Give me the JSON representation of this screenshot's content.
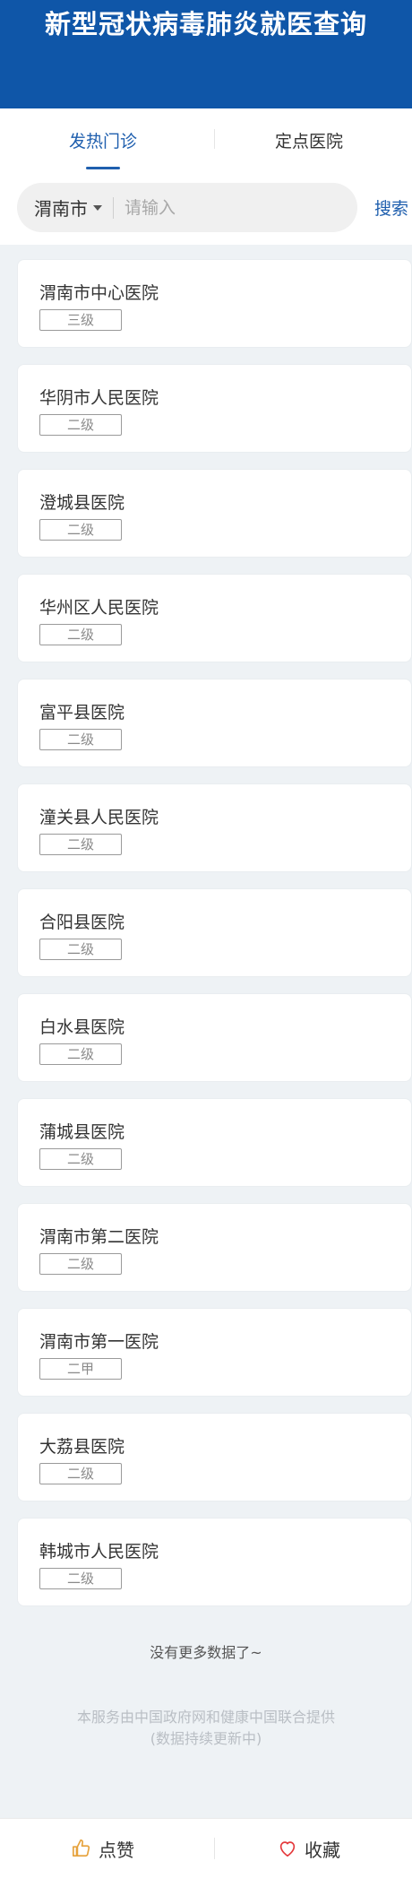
{
  "header": {
    "title": "新型冠状病毒肺炎就医查询"
  },
  "tabs": [
    {
      "label": "发热门诊",
      "active": true
    },
    {
      "label": "定点医院",
      "active": false
    }
  ],
  "search": {
    "city": "渭南市",
    "placeholder": "请输入",
    "value": "",
    "button_label": "搜索"
  },
  "hospitals": [
    {
      "name": "渭南市中心医院",
      "level": "三级"
    },
    {
      "name": "华阴市人民医院",
      "level": "二级"
    },
    {
      "name": "澄城县医院",
      "level": "二级"
    },
    {
      "name": "华州区人民医院",
      "level": "二级"
    },
    {
      "name": "富平县医院",
      "level": "二级"
    },
    {
      "name": "潼关县人民医院",
      "level": "二级"
    },
    {
      "name": "合阳县医院",
      "level": "二级"
    },
    {
      "name": "白水县医院",
      "level": "二级"
    },
    {
      "name": "蒲城县医院",
      "level": "二级"
    },
    {
      "name": "渭南市第二医院",
      "level": "二级"
    },
    {
      "name": "渭南市第一医院",
      "level": "二甲"
    },
    {
      "name": "大荔县医院",
      "level": "二级"
    },
    {
      "name": "韩城市人民医院",
      "level": "二级"
    }
  ],
  "list_end_text": "没有更多数据了~",
  "footer": {
    "line1": "本服务由中国政府网和健康中国联合提供",
    "line2": "(数据持续更新中)"
  },
  "bottom_bar": {
    "like_label": "点赞",
    "like_icon": "thumbs-up-icon",
    "favorite_label": "收藏",
    "favorite_icon": "heart-icon"
  },
  "colors": {
    "header_bg": "#0f56a8",
    "accent": "#1f5fae",
    "like_icon": "#e6a23c",
    "favorite_icon": "#e4393c"
  }
}
